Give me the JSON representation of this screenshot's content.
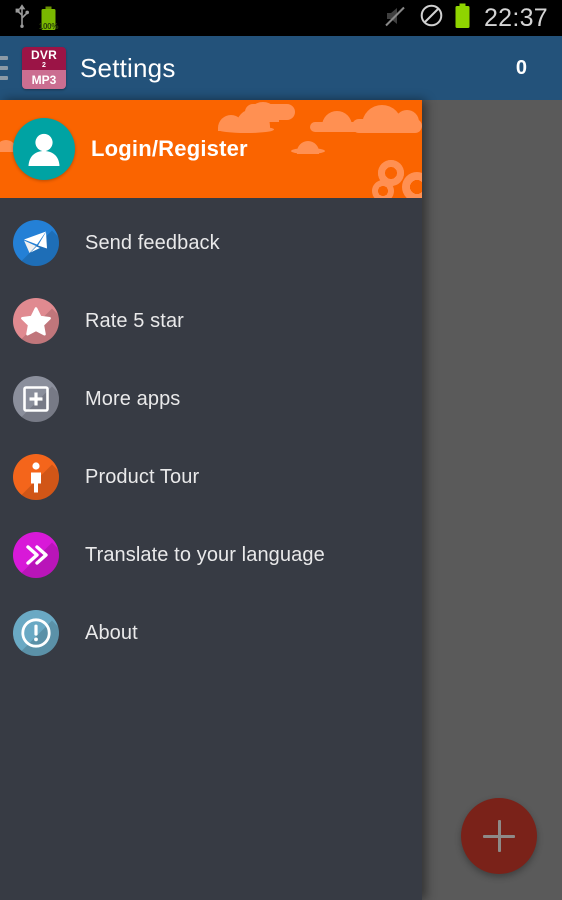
{
  "status_bar": {
    "usb_icon": "usb-icon",
    "battery_charge_icon": "battery-charging-icon",
    "battery_percent": "100%",
    "mute_icon": "volume-mute-icon",
    "dnd_icon": "do-not-disturb-icon",
    "battery_icon": "battery-full-icon",
    "clock": "22:37",
    "background": "#000000"
  },
  "action_bar": {
    "menu_icon": "hamburger-menu-icon",
    "app_icon": {
      "name": "dvr2mp3-app-icon",
      "line1": "DVR",
      "line2": "2",
      "line3": "MP3",
      "top_color": "#9b1446",
      "bottom_color": "#cb6e91"
    },
    "title": "Settings",
    "count": "0",
    "background": "#23527a"
  },
  "drawer": {
    "background": "#373b44",
    "header": {
      "avatar_icon": "user-avatar-icon",
      "label": "Login/Register",
      "background": "#fa6400",
      "decor_color": "#ff9052",
      "avatar_color": "#00a3a3"
    },
    "items": [
      {
        "icon": "envelope-icon",
        "label": "Send feedback",
        "color": "#2480d6"
      },
      {
        "icon": "star-icon",
        "label": "Rate 5 star",
        "color": "#e08a90"
      },
      {
        "icon": "square-plus-icon",
        "label": "More apps",
        "color": "#8b8f9c"
      },
      {
        "icon": "pedestrian-icon",
        "label": "Product Tour",
        "color": "#f4651b"
      },
      {
        "icon": "double-chevron-icon",
        "label": "Translate to your language",
        "color": "#d819d8"
      },
      {
        "icon": "exclamation-circle-icon",
        "label": "About",
        "color": "#6aa9c4"
      }
    ]
  },
  "scrim": {
    "background": "#5a5a5a"
  },
  "fab": {
    "icon": "plus-icon",
    "background": "#7a2219",
    "glyph_color": "#8e8a88"
  }
}
